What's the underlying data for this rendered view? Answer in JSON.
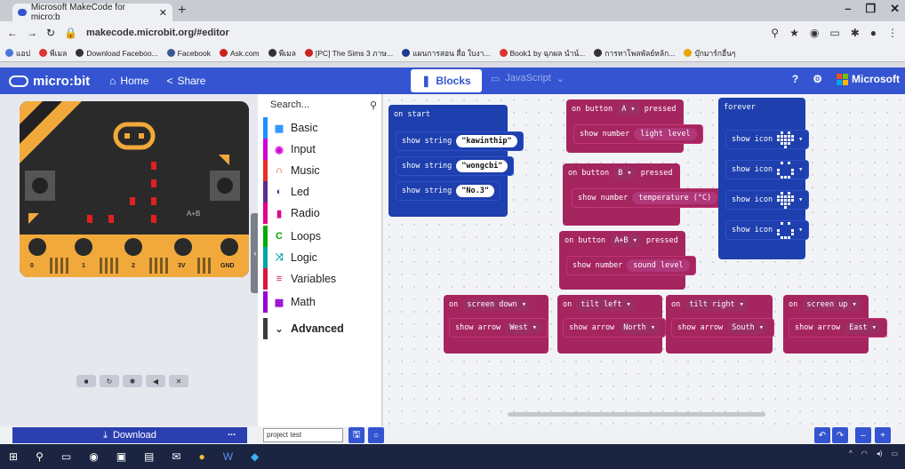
{
  "browser": {
    "tab_title": "Microsoft MakeCode for micro:b",
    "url": "makecode.microbit.org/#editor",
    "bookmarks": [
      {
        "label": "แอป",
        "color": "#4a78d6"
      },
      {
        "label": "พีเมล",
        "color": "#d33"
      },
      {
        "label": "Download Faceboo...",
        "color": "#333"
      },
      {
        "label": "Facebook",
        "color": "#3b5998"
      },
      {
        "label": "Ask.com",
        "color": "#c22"
      },
      {
        "label": "พีเมล",
        "color": "#333"
      },
      {
        "label": "[PC] The Sims 3 ภาษ...",
        "color": "#c22"
      },
      {
        "label": "แผนการสอน สื่อ ใบงา...",
        "color": "#1e3c8c"
      },
      {
        "label": "Book1 by ฉุกผล นำน์...",
        "color": "#d33"
      },
      {
        "label": "การหาโพลพัลย์หล้ก...",
        "color": "#333"
      },
      {
        "label": "บุ๊กมาร์กอื่นๆ",
        "color": "#e8a400"
      }
    ]
  },
  "header": {
    "logo": "micro:bit",
    "home": "Home",
    "share": "Share",
    "blocks": "Blocks",
    "javascript": "JavaScript",
    "microsoft": "Microsoft"
  },
  "toolbox": {
    "search_placeholder": "Search...",
    "categories": [
      {
        "label": "Basic",
        "color": "#1e90ff",
        "icon": "grid-icon",
        "glyph": "▦"
      },
      {
        "label": "Input",
        "color": "#d400d4",
        "icon": "target-icon",
        "glyph": "◉"
      },
      {
        "label": "Music",
        "color": "#e63022",
        "icon": "headphones-icon",
        "glyph": "∩"
      },
      {
        "label": "Led",
        "color": "#5c2d91",
        "icon": "toggle-icon",
        "glyph": "◐"
      },
      {
        "label": "Radio",
        "color": "#e3008c",
        "icon": "signal-icon",
        "glyph": "▮"
      },
      {
        "label": "Loops",
        "color": "#00aa00",
        "icon": "loop-icon",
        "glyph": "C"
      },
      {
        "label": "Logic",
        "color": "#00a4a6",
        "icon": "shuffle-icon",
        "glyph": "⤨"
      },
      {
        "label": "Variables",
        "color": "#dc143c",
        "icon": "list-icon",
        "glyph": "≡"
      },
      {
        "label": "Math",
        "color": "#9400d3",
        "icon": "calculator-icon",
        "glyph": "▦"
      },
      {
        "label": "Advanced",
        "color": "#3c3c3c",
        "icon": "chevron-down-icon",
        "glyph": "⌄"
      }
    ]
  },
  "blocks": {
    "on_start": {
      "label": "on start",
      "rows": [
        {
          "label": "show string",
          "value": "kawinthip"
        },
        {
          "label": "show string",
          "value": "wongcbi"
        },
        {
          "label": "show string",
          "value": "No.3"
        }
      ]
    },
    "button_a": {
      "event": "on button",
      "key": "A",
      "suffix": "pressed",
      "cmd": "show number",
      "value": "light level"
    },
    "button_b": {
      "event": "on button",
      "key": "B",
      "suffix": "pressed",
      "cmd": "show number",
      "value": "temperature (°C)"
    },
    "button_ab": {
      "event": "on button",
      "key": "A+B",
      "suffix": "pressed",
      "cmd": "show number",
      "value": "sound level"
    },
    "forever": {
      "label": "forever",
      "cmd": "show icon",
      "count": 4
    },
    "gestures": [
      {
        "event": "on",
        "gesture": "screen down",
        "cmd": "show arrow",
        "dir": "West"
      },
      {
        "event": "on",
        "gesture": "tilt left",
        "cmd": "show arrow",
        "dir": "North"
      },
      {
        "event": "on",
        "gesture": "tilt right",
        "cmd": "show arrow",
        "dir": "South"
      },
      {
        "event": "on",
        "gesture": "screen up",
        "cmd": "show arrow",
        "dir": "East"
      }
    ]
  },
  "simulator": {
    "pins": [
      "0",
      "1",
      "2",
      "3V",
      "GND"
    ],
    "ab_label": "A+B"
  },
  "bottom": {
    "download": "Download",
    "more": "...",
    "project_name": "project test"
  },
  "colors": {
    "blue": "#1e3fae",
    "pink": "#a5255f",
    "header": "#3454d1"
  }
}
